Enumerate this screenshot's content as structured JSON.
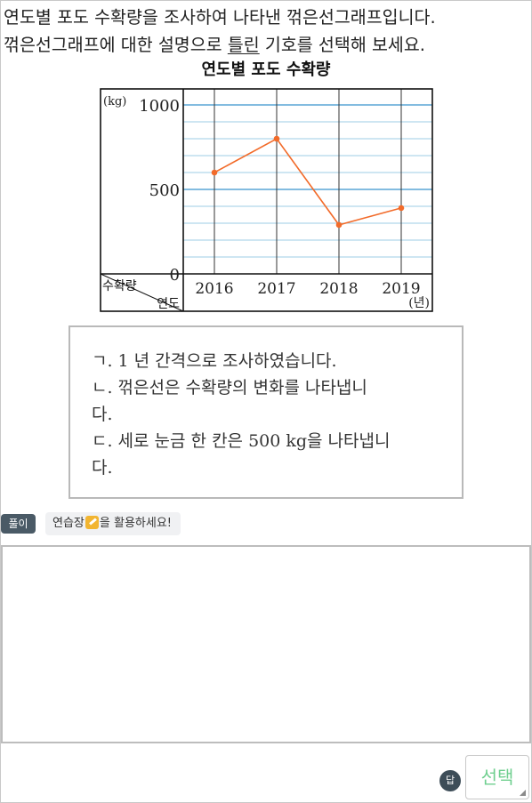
{
  "question": {
    "line1": "연도별 포도 수확량을 조사하여 나타낸 꺾은선그래프입니다.",
    "line2_before": "꺾은선그래프에 대한 설명으로 ",
    "line2_underlined": "틀린",
    "line2_after": " 기호를 선택해 보세요."
  },
  "chart_data": {
    "type": "line",
    "title": "연도별 포도 수확량",
    "unit_y": "(kg)",
    "unit_x": "(년)",
    "corner_top": "수확량",
    "corner_bottom": "연도",
    "categories": [
      "2016",
      "2017",
      "2018",
      "2019"
    ],
    "values": [
      600,
      800,
      290,
      390
    ],
    "yticks": [
      0,
      500,
      1000
    ],
    "ylim": [
      0,
      1000
    ],
    "minor_step": 100,
    "line_color": "#f26b2a",
    "grid_color": "#9ccde6"
  },
  "statements": [
    "ㄱ. 1 년 간격으로 조사하였습니다.",
    "ㄴ. 꺾은선은 수확량의 변화를 나타냅니",
    "다.",
    "ㄷ. 세로 눈금 한 칸은 500 kg을 나타냅니",
    "다."
  ],
  "toolbar": {
    "solution_tag": "풀이",
    "hint_before": "연습장",
    "hint_after": "을 활용하세요!"
  },
  "answer": {
    "badge": "답",
    "select_label": "선택"
  }
}
